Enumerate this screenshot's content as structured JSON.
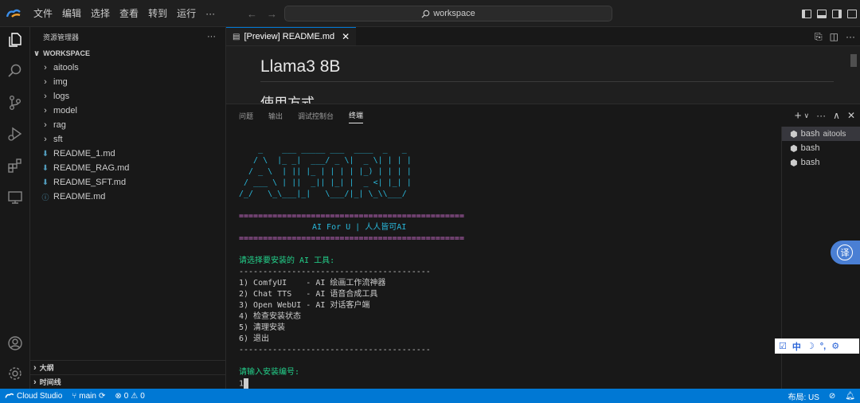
{
  "menu": {
    "file": "文件",
    "edit": "编辑",
    "selection": "选择",
    "view": "查看",
    "go": "转到",
    "run": "运行",
    "more": "···"
  },
  "search": {
    "label": "workspace"
  },
  "sidebar": {
    "title": "资源管理器",
    "more": "···",
    "workspace_label": "WORKSPACE",
    "items": [
      {
        "label": "aitools",
        "type": "folder"
      },
      {
        "label": "img",
        "type": "folder"
      },
      {
        "label": "logs",
        "type": "folder"
      },
      {
        "label": "model",
        "type": "folder"
      },
      {
        "label": "rag",
        "type": "folder"
      },
      {
        "label": "sft",
        "type": "folder"
      },
      {
        "label": "README_1.md",
        "type": "markdown"
      },
      {
        "label": "README_RAG.md",
        "type": "markdown"
      },
      {
        "label": "README_SFT.md",
        "type": "markdown"
      },
      {
        "label": "README.md",
        "type": "info"
      }
    ],
    "outline_label": "大纲",
    "timeline_label": "时间线"
  },
  "editor": {
    "tab_label": "[Preview] README.md",
    "heading": "Llama3 8B",
    "subheading": "使用方式"
  },
  "panel": {
    "tabs": [
      "问题",
      "输出",
      "调试控制台",
      "终端"
    ],
    "active_tab": "终端"
  },
  "terminal": {
    "art_lines": [
      "    _    ___ _____ ___  ____  _   _",
      "   / \\  |_ _|  ___/ _ \\|  _ \\| | | |",
      "  / _ \\  | || |_ | | | | |_) | | | |",
      " / ___ \\ | ||  _|| |_| |  _ <| |_| |",
      "/_/   \\_\\___|_|   \\___/|_| \\_\\\\___/"
    ],
    "separator": "===============================================",
    "banner": "AI For U | 人人皆可AI",
    "prompt": "请选择要安装的 AI 工具:",
    "dash": "----------------------------------------",
    "options": [
      "1) ComfyUI    - AI 绘画工作流神器",
      "2) Chat TTS   - AI 语音合成工具",
      "3) Open WebUI - AI 对话客户端",
      "4) 检查安装状态",
      "5) 清理安装",
      "6) 退出"
    ],
    "input_prompt": "请输入安装编号:",
    "input_value": "1"
  },
  "terminal_list": [
    {
      "name": "bash",
      "detail": "aitools"
    },
    {
      "name": "bash",
      "detail": ""
    },
    {
      "name": "bash",
      "detail": ""
    }
  ],
  "translate_button": "译",
  "ime": {
    "lang": "中"
  },
  "statusbar": {
    "brand": "Cloud Studio",
    "branch": "main",
    "errors": "0",
    "warnings": "0",
    "layout": "布局: US"
  },
  "colors": {
    "accent": "#0078d4",
    "terminal_cyan": "#29b8db",
    "terminal_magenta": "#d670d6",
    "terminal_green": "#23d18b",
    "markdown_icon": "#519aba"
  }
}
